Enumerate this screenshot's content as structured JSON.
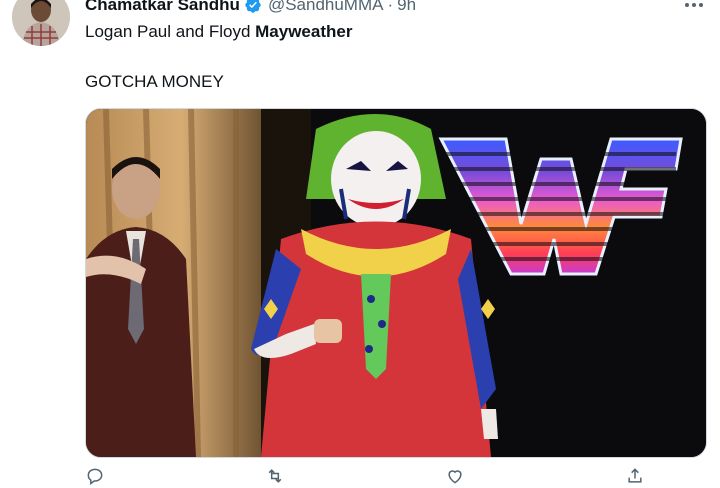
{
  "tweet": {
    "display_name": "Chamatkar Sandhu",
    "handle": "@SandhuMMA",
    "separator": "·",
    "time": "9h",
    "text_line1_prefix": "Logan Paul and Floyd ",
    "text_line1_bold": "Mayweather",
    "text_line2": "GOTCHA MONEY"
  },
  "icons": {
    "verified": "verified-badge-icon",
    "more": "more-options-icon",
    "reply": "reply-icon",
    "retweet": "retweet-icon",
    "like": "like-icon",
    "share": "share-icon"
  },
  "colors": {
    "verified": "#1d9bf0",
    "secondary_text": "#536471",
    "border": "#cfd9de"
  },
  "media": {
    "type": "gif",
    "neon_logo": "WF"
  }
}
